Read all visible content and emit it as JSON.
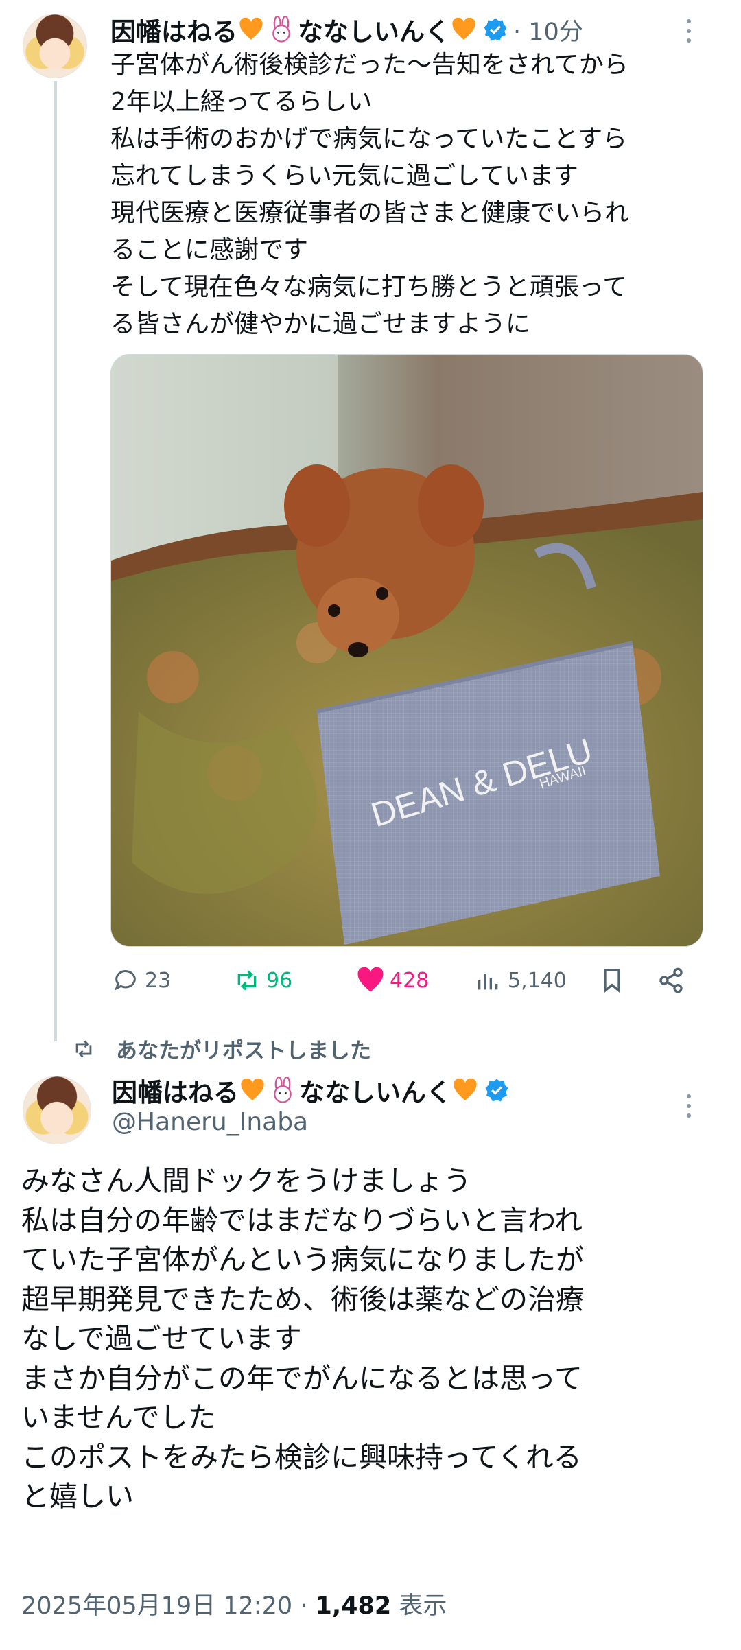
{
  "post1": {
    "display_name": "因幡はねる",
    "display_name_2": "ななしいんく",
    "time_ago": "· 10分",
    "text": "子宮体がん術後検診だった〜告知をされてから\n2年以上経ってるらしい\n私は手術のおかげで病気になっていたことすら\n忘れてしまうくらい元気に過ごしています\n現代医療と医療従事者の皆さまと健康でいられ\nることに感謝です\nそして現在色々な病気に打ち勝とうと頑張って\nる皆さんが健やかに過ごせますように",
    "photo": {
      "bag_text_1": "DEAN & DELU",
      "bag_text_2": "HAWAII"
    },
    "replies": "23",
    "reposts": "96",
    "likes": "428",
    "views": "5,140"
  },
  "repost_note": "あなたがリポストしました",
  "post2": {
    "display_name": "因幡はねる",
    "display_name_2": "ななしいんく",
    "handle": "@Haneru_Inaba",
    "text": "みなさん人間ドックをうけましょう\n私は自分の年齢ではまだなりづらいと言われ\nていた子宮体がんという病気になりましたが\n超早期発見できたため、術後は薬などの治療\nなしで過ごせています\nまさか自分がこの年でがんになるとは思って\nいませんでした\nこのポストをみたら検診に興味持ってくれる\nと嬉しい",
    "date": "2025年05月19日 12:20 · ",
    "view_count": "1,482",
    "view_label": " 表示"
  },
  "colors": {
    "like": "#f91880",
    "repost": "#00ba7c",
    "verified": "#1d9bf0",
    "secondary_text": "#536471",
    "heart_emoji": "#ff9a1f"
  }
}
